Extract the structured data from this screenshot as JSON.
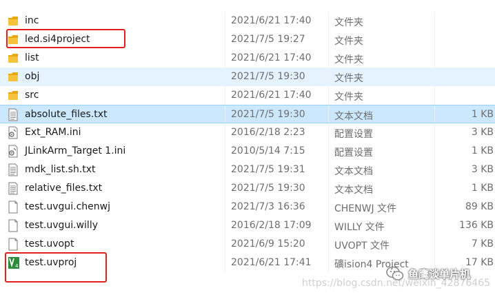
{
  "files": [
    {
      "name": "inc",
      "date": "2021/6/21 17:40",
      "type": "文件夹",
      "size": "",
      "icon": "folder-icon",
      "state": "normal"
    },
    {
      "name": "led.si4project",
      "date": "2021/7/5 19:27",
      "type": "文件夹",
      "size": "",
      "icon": "folder-icon",
      "state": "normal"
    },
    {
      "name": "list",
      "date": "2021/6/21 17:40",
      "type": "文件夹",
      "size": "",
      "icon": "folder-icon",
      "state": "normal"
    },
    {
      "name": "obj",
      "date": "2021/7/5 19:30",
      "type": "文件夹",
      "size": "",
      "icon": "folder-icon",
      "state": "hover"
    },
    {
      "name": "src",
      "date": "2021/6/21 17:40",
      "type": "文件夹",
      "size": "",
      "icon": "folder-icon",
      "state": "normal"
    },
    {
      "name": "absolute_files.txt",
      "date": "2021/7/5 19:30",
      "type": "文本文档",
      "size": "1 KB",
      "icon": "text-file-icon",
      "state": "selected"
    },
    {
      "name": "Ext_RAM.ini",
      "date": "2016/2/18 2:23",
      "type": "配置设置",
      "size": "3 KB",
      "icon": "config-file-icon",
      "state": "normal"
    },
    {
      "name": "JLinkArm_Target 1.ini",
      "date": "2010/5/14 7:15",
      "type": "配置设置",
      "size": "1 KB",
      "icon": "config-file-icon",
      "state": "normal"
    },
    {
      "name": "mdk_list.sh.txt",
      "date": "2021/7/5 19:31",
      "type": "文本文档",
      "size": "3 KB",
      "icon": "text-file-icon",
      "state": "normal"
    },
    {
      "name": "relative_files.txt",
      "date": "2021/7/5 19:30",
      "type": "文本文档",
      "size": "1 KB",
      "icon": "text-file-icon",
      "state": "normal"
    },
    {
      "name": "test.uvgui.chenwj",
      "date": "2021/7/3 16:36",
      "type": "CHENWJ 文件",
      "size": "89 KB",
      "icon": "blank-file-icon",
      "state": "normal"
    },
    {
      "name": "test.uvgui.willy",
      "date": "2016/2/18 17:09",
      "type": "WILLY 文件",
      "size": "136 KB",
      "icon": "blank-file-icon",
      "state": "normal"
    },
    {
      "name": "test.uvopt",
      "date": "2021/6/9 15:20",
      "type": "UVOPT 文件",
      "size": "7 KB",
      "icon": "blank-file-icon",
      "state": "normal"
    },
    {
      "name": "test.uvproj",
      "date": "2021/6/21 17:41",
      "type": "礦ision4 Project",
      "size": "17 KB",
      "icon": "uvision-project-icon",
      "state": "normal"
    }
  ],
  "watermark": "https://blog.csdn.net/weixin_42876465",
  "wechat_label": "鱼鹰谈单片机",
  "colors": {
    "folder": "#f5c33b",
    "highlight_box": "#e0201b",
    "selected_bg": "#cce8ff",
    "hover_bg": "#e5f3ff"
  }
}
